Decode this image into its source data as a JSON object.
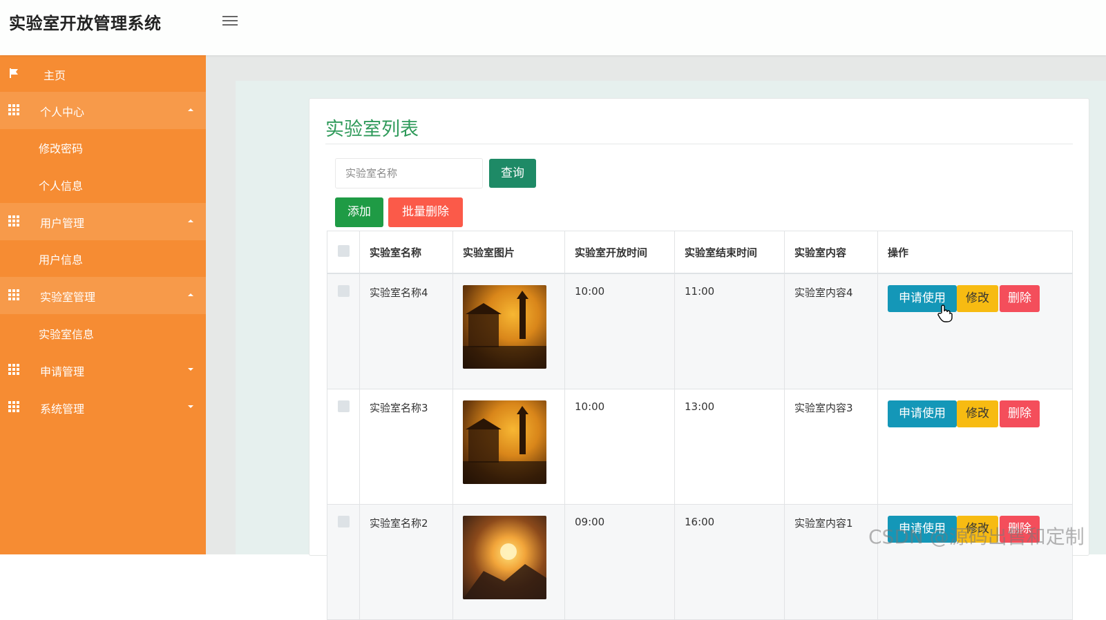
{
  "header": {
    "title": "实验室开放管理系统"
  },
  "sidebar": {
    "home": "主页",
    "groups": [
      {
        "label": "个人中心",
        "items": [
          "修改密码",
          "个人信息"
        ]
      },
      {
        "label": "用户管理",
        "items": [
          "用户信息"
        ]
      },
      {
        "label": "实验室管理",
        "items": [
          "实验室信息"
        ]
      },
      {
        "label": "申请管理",
        "items": []
      },
      {
        "label": "系统管理",
        "items": []
      }
    ]
  },
  "main": {
    "title": "实验室列表",
    "search": {
      "placeholder": "实验室名称",
      "value": ""
    },
    "buttons": {
      "query": "查询",
      "add": "添加",
      "batch_delete": "批量删除"
    },
    "table": {
      "columns": [
        "实验室名称",
        "实验室图片",
        "实验室开放时间",
        "实验室结束时间",
        "实验室内容",
        "操作"
      ],
      "rows": [
        {
          "name": "实验室名称4",
          "open": "10:00",
          "close": "11:00",
          "content": "实验室内容4"
        },
        {
          "name": "实验室名称3",
          "open": "10:00",
          "close": "13:00",
          "content": "实验室内容3"
        },
        {
          "name": "实验室名称2",
          "open": "09:00",
          "close": "16:00",
          "content": "实验室内容1"
        }
      ],
      "actions": {
        "apply": "申请使用",
        "edit": "修改",
        "delete": "删除"
      }
    }
  },
  "watermark": "CSDN @源码出售和定制",
  "colors": {
    "sidebar": "#f68c33",
    "title_green": "#2f9a5a",
    "apply": "#1497b8",
    "edit": "#f7bb12",
    "delete": "#f44e5b"
  },
  "icons": [
    "menu-icon",
    "flag-icon",
    "grid-icon",
    "caret-up-icon",
    "caret-down-icon",
    "hand-cursor-icon"
  ]
}
